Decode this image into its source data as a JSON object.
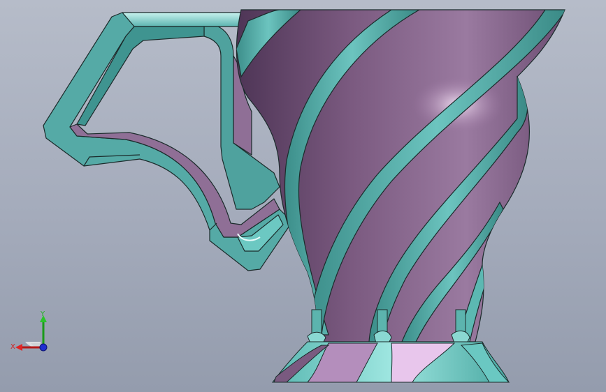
{
  "viewport": {
    "colors": {
      "background_top": "#b6bcc9",
      "background_bottom": "#949cad",
      "body_purple": "#7e5f82",
      "body_highlight": "#e6c6e8",
      "rib_teal": "#4fa8a4",
      "rib_teal_light": "#9ce0dc",
      "edge": "#1b2b2b"
    }
  },
  "triad": {
    "x_label": "X",
    "y_label": "Y",
    "x_color": "#d02020",
    "y_color": "#21b021",
    "z_color": "#1f2fd0"
  }
}
